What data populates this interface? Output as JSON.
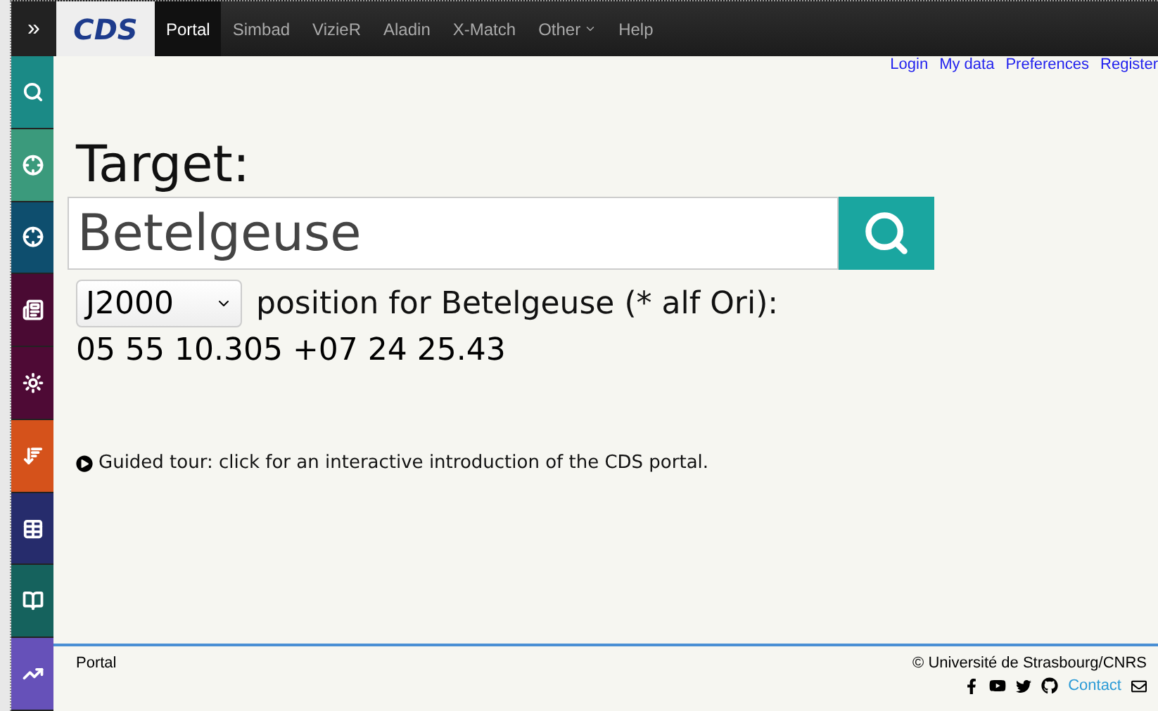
{
  "header": {
    "expand": "»",
    "logo": "CDS",
    "nav": [
      {
        "label": "Portal",
        "selected": true,
        "has_menu": false
      },
      {
        "label": "Simbad",
        "selected": false,
        "has_menu": false
      },
      {
        "label": "VizieR",
        "selected": false,
        "has_menu": false
      },
      {
        "label": "Aladin",
        "selected": false,
        "has_menu": false
      },
      {
        "label": "X-Match",
        "selected": false,
        "has_menu": false
      },
      {
        "label": "Other",
        "selected": false,
        "has_menu": true
      },
      {
        "label": "Help",
        "selected": false,
        "has_menu": false
      }
    ]
  },
  "user_links": [
    "Login",
    "My data",
    "Preferences",
    "Register"
  ],
  "sidebar": {
    "items": [
      {
        "color": "#1b8a86"
      },
      {
        "color": "#3b9a7c"
      },
      {
        "color": "#0e4e6e"
      },
      {
        "color": "#4a0a33"
      },
      {
        "color": "#4e0a35"
      },
      {
        "color": "#d5521b"
      },
      {
        "color": "#262c6c"
      },
      {
        "color": "#15625d"
      },
      {
        "color": "#6651b9"
      }
    ]
  },
  "search": {
    "label": "Target:",
    "value": "Betelgeuse"
  },
  "result": {
    "epoch": "J2000",
    "description": "position for Betelgeuse (* alf Ori):",
    "coordinates": "05 55 10.305 +07 24 25.43"
  },
  "guided_tour": "Guided tour: click for an interactive introduction of the CDS portal.",
  "footer": {
    "left": "Portal",
    "copyright": "© Université de Strasbourg/CNRS",
    "contact": "Contact"
  }
}
